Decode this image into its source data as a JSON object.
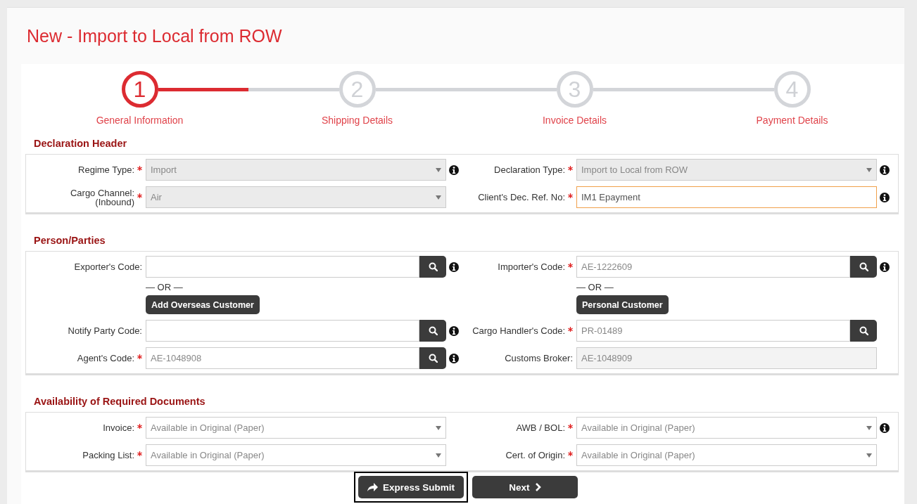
{
  "page_title": "New - Import to Local from ROW",
  "steps": [
    {
      "number": "1",
      "label": "General Information",
      "current": true
    },
    {
      "number": "2",
      "label": "Shipping Details",
      "current": false
    },
    {
      "number": "3",
      "label": "Invoice Details",
      "current": false
    },
    {
      "number": "4",
      "label": "Payment Details",
      "current": false
    }
  ],
  "sections": [
    {
      "title": "Declaration Header",
      "rows": [
        {
          "left": {
            "label": "Regime Type:",
            "required": true,
            "kind": "select",
            "value": "Import",
            "disabled": true,
            "info": true
          },
          "right": {
            "label": "Declaration Type:",
            "required": true,
            "kind": "select",
            "value": "Import to Local from ROW",
            "disabled": true,
            "info": true
          }
        },
        {
          "left": {
            "label": "Cargo Channel:\n(Inbound)",
            "required": true,
            "kind": "select",
            "value": "Air",
            "disabled": true,
            "info": false
          },
          "right": {
            "label": "Client's Dec. Ref. No:",
            "required": true,
            "kind": "text",
            "value": "IM1 Epayment",
            "disabled": false,
            "focused": true,
            "info": true
          }
        }
      ]
    },
    {
      "title": "Person/Parties",
      "rows": [
        {
          "left": {
            "label": "Exporter's Code:",
            "required": false,
            "kind": "lookup",
            "disabled": false,
            "info": true,
            "alternative": {
              "separator": "— OR —",
              "button": "Add Overseas Customer"
            }
          },
          "right": {
            "label": "Importer's Code:",
            "required": true,
            "kind": "lookup",
            "value": "AE-1222609",
            "disabled": false,
            "info": true,
            "alternative": {
              "separator": "— OR —",
              "button": "Personal Customer"
            }
          }
        },
        {
          "left": {
            "label": "Notify Party Code:",
            "required": false,
            "kind": "lookup",
            "disabled": false,
            "info": true
          },
          "right": {
            "label": "Cargo Handler's Code:",
            "required": true,
            "kind": "lookup",
            "value": "PR-01489",
            "disabled": false,
            "info": false
          }
        },
        {
          "left": {
            "label": "Agent's Code:",
            "required": true,
            "kind": "lookup",
            "value": "AE-1048908",
            "disabled": false,
            "info": true
          },
          "right": {
            "label": "Customs Broker:",
            "required": false,
            "kind": "text",
            "value": "AE-1048909",
            "disabled": true,
            "info": false
          }
        }
      ]
    },
    {
      "title": "Availability of Required Documents",
      "rows": [
        {
          "left": {
            "label": "Invoice:",
            "required": true,
            "kind": "select",
            "value": "Available in Original (Paper)",
            "disabled": false,
            "info": false
          },
          "right": {
            "label": "AWB / BOL:",
            "required": true,
            "kind": "select",
            "value": "Available in Original (Paper)",
            "disabled": false,
            "info": true
          }
        },
        {
          "left": {
            "label": "Packing List:",
            "required": true,
            "kind": "select",
            "value": "Available in Original (Paper)",
            "disabled": false,
            "info": false
          },
          "right": {
            "label": "Cert. of Origin:",
            "required": true,
            "kind": "select",
            "value": "Available in Original (Paper)",
            "disabled": false,
            "info": false
          }
        }
      ]
    }
  ],
  "buttons": [
    {
      "label": "Express Submit",
      "kind": "submit",
      "focused": true
    },
    {
      "label": "Next",
      "kind": "next",
      "focused": false
    }
  ]
}
